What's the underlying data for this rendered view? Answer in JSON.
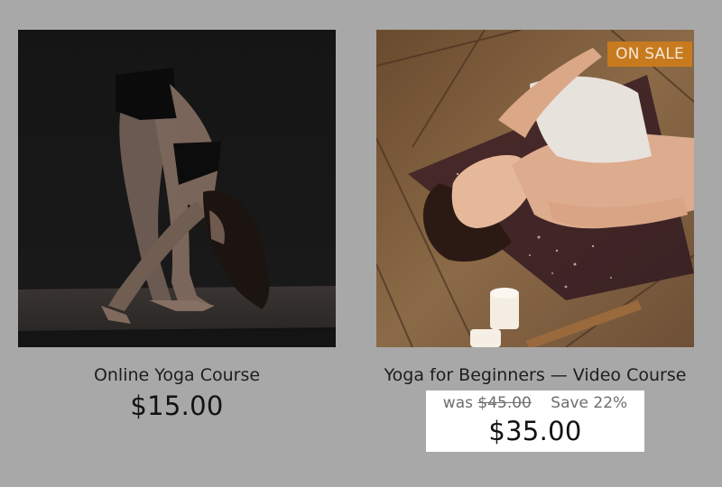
{
  "products": [
    {
      "title": "Online Yoga Course",
      "price": "$15.00",
      "image_alt": "forward-fold-yoga-photo"
    },
    {
      "title": "Yoga for Beginners — Video Course",
      "badge": "ON SALE",
      "was_label": "was",
      "was_price": "$45.00",
      "save_text": "Save 22%",
      "price": "$35.00",
      "image_alt": "woman-lying-on-yoga-mat-photo"
    }
  ],
  "colors": {
    "page_background": "#a8a8a8",
    "badge_background": "#c87a1e",
    "sale_box_background": "#ffffff"
  }
}
